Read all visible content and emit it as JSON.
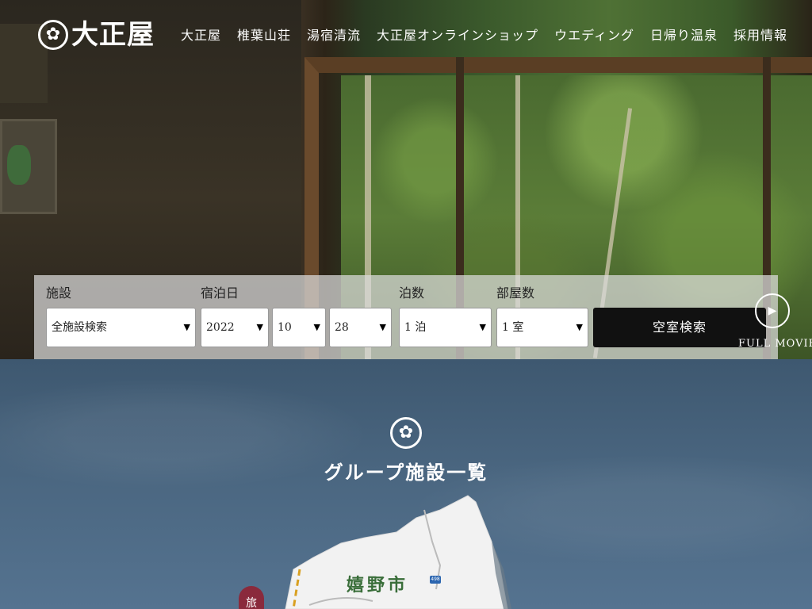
{
  "header": {
    "logo_text": "大正屋",
    "nav": [
      "大正屋",
      "椎葉山荘",
      "湯宿清流",
      "大正屋オンラインショップ",
      "ウエディング",
      "日帰り温泉",
      "採用情報"
    ]
  },
  "search": {
    "facility_label": "施設",
    "facility_value": "全施設検索",
    "date_label": "宿泊日",
    "year_value": "2022",
    "month_value": "10",
    "day_value": "28",
    "nights_label": "泊数",
    "nights_value": "1 泊",
    "rooms_label": "部屋数",
    "rooms_value": "1 室",
    "button_label": "空室検索"
  },
  "movie": {
    "label": "FULL MOVIE"
  },
  "section": {
    "title": "グループ施設一覧",
    "city": "嬉野市",
    "road_number": "498",
    "pin_label": "旅"
  },
  "icons": {
    "chevron": "chevron-down-icon",
    "crest": "crest-icon",
    "play": "play-icon"
  }
}
